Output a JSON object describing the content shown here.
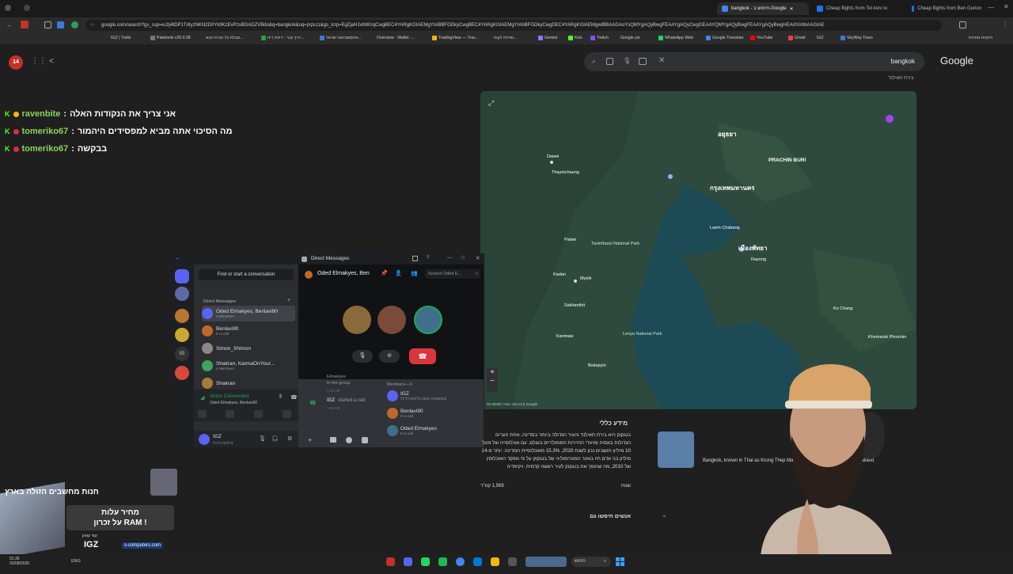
{
  "browser": {
    "tabs": [
      {
        "label": "bangkok - חיפוש ב-Google",
        "active": true
      },
      {
        "label": "Cheap flights from Tel Aviv to",
        "active": false
      },
      {
        "label": "Cheap flights from Ben Gurion",
        "active": false
      }
    ],
    "url": "google.com/search?gs_ssp=eJzj4tDP1TdIyzNKN2D0Yk9KzEvPzsBGADZVBdo&q=bangkok&oq=בנגקוק&gs_lcrp=EgZjaHJvbWUqCwgBEC4YARgKGIAEMgYIABBFGDkyCwgBEC4YARgKGIAEMgYIAhBFGDkyCwgDEC4YARgKGIAEMgwIBBAAGAoYsQMYgAQyBwgFEAAYgAQyCwgGEAAYQMYgAQyBwgFEAAYgAQyBwgHEAAYAhbAAGIAE",
    "bookmarks": [
      "IGZ | Trello",
      "Paletools v26.0.28",
      "טבלת כל הבית הבא...",
      "דרך גבר - דיוות ריח...",
      "אינסטגראם ישראל...",
      "Overview · Wallet -...",
      "TradingView — Trac...",
      "שירות לקוח...",
      "Gemini",
      "Kick",
      "Twitch",
      "Google זמן",
      "WhatsApp Web",
      "Google Translate",
      "YouTube",
      "Gmail",
      "IGZ",
      "SkyWay Tours",
      "תיקיות אחרות"
    ]
  },
  "google": {
    "query": "bangkok",
    "logo": "Google",
    "map_attribution": "20 ק\"מ  נתוני מפה ©2026 Google",
    "info_heading": "מידע כללי",
    "info_text": "בנגקוק היא בירת תאילנד והעיר הגדולה ביותר במדינה. אחת הערים הגדולות באסיה ומיעדי התיירות הפופולריים בעולם. עם אוכלוסייה של מעל 10 מיליון תושבים נכון לשנת 2020, 15.3% מאוכלוסיית המדינה. יותר מ-14 מיליון בני אדם חיו באזור המטרופוליני של בנגקוק על פי מפקד האוכלוסין של 2010, מה שהופך את בנגקוק לעיר ראשה קדמית. ויקיפדיה",
    "area_label": "שטח",
    "area_value": "1,569 קמ\"ר",
    "people_also_search": "אנשים חיפשו גם",
    "card_text": "Bangkok, known in Thai as Krung Thep Maha Nakhon ... is the capital of Thailand",
    "breadcrumb": "בירת תאילנד"
  },
  "chat": [
    {
      "user": "ravenbite",
      "message": "אני צריך את הנקודות האלה"
    },
    {
      "user": "tomeriko67",
      "message": "מה הסיכוי אתה מביא למפסידים היהמור"
    },
    {
      "user": "tomeriko67",
      "message": "בבקשה"
    }
  ],
  "discord": {
    "window_title": "Direct Messages",
    "find_placeholder": "Find or start a conversation",
    "dm_header": "Direct Messages",
    "conversation_title": "Oded Elmakyes, Ben",
    "search_placeholder": "Search Oded E...",
    "dms": [
      {
        "name": "Oded Elmakyes, Benlavi90",
        "sub": "3 Members",
        "color": "#5865f2"
      },
      {
        "name": "Benlavi90",
        "sub": "In a call",
        "color": "#c0682b"
      },
      {
        "name": "Simon_Shimon",
        "sub": "",
        "color": "#888888"
      },
      {
        "name": "Shakran, KarmaOnYour...",
        "sub": "4 Members",
        "color": "#3ba55d"
      },
      {
        "name": "Shakran",
        "sub": "",
        "color": "#a87c3a"
      }
    ],
    "voice_status": "Voice Connected",
    "voice_channel": "Oded Elmakyes, Benlavi90",
    "user_name": "IGZ",
    "user_status": "בליבות כל כל",
    "chat_system_1": "Elmakyes",
    "chat_system_2": "to the group.",
    "chat_time_1": "1:36 AM",
    "chat_started_user": "IGZ",
    "chat_started_text": "started a call.",
    "chat_time_2": "1:36 AM",
    "members_label": "Members—3",
    "members": [
      {
        "name": "IGZ",
        "sub": "בליבות כל כל KICK.COM/IGZ",
        "color": "#5865f2"
      },
      {
        "name": "Benlavi90",
        "sub": "In a call",
        "color": "#c0682b"
      },
      {
        "name": "Oded Elmakyes",
        "sub": "In a call",
        "color": "#3f6f8a"
      }
    ]
  },
  "map_labels": [
    {
      "text": "Dawei"
    },
    {
      "text": "Thayetchaung"
    },
    {
      "text": "Palaw"
    },
    {
      "text": "Myeik"
    },
    {
      "text": "Kadan"
    },
    {
      "text": "Sakhanthit"
    },
    {
      "text": "Kanmaw"
    },
    {
      "text": "Bokepyin"
    },
    {
      "text": "Laem Chabang"
    },
    {
      "text": "Rayong"
    },
    {
      "text": "Ko Chang"
    },
    {
      "text": "Khemarak Phoumin"
    },
    {
      "text": "PRACHIN BURI"
    },
    {
      "text": "อยุธยา"
    },
    {
      "text": "กรุงเทพมหานคร"
    },
    {
      "text": "เมืองพัทยา"
    },
    {
      "text": "Tanintharyi National Park"
    },
    {
      "text": "Lenya National Park"
    }
  ],
  "promo": {
    "title": "חנות מחשבים הזולה בארץ",
    "line1": "מחיר עלות",
    "line2": "על זכרון RAM !",
    "code_label": "קוד קופון:",
    "code": "IGZ",
    "site": "s-computers.com"
  },
  "taskbar": {
    "time": "01:36",
    "date": "03/08/2026",
    "lang": "ENG",
    "search": "חיפוש"
  }
}
